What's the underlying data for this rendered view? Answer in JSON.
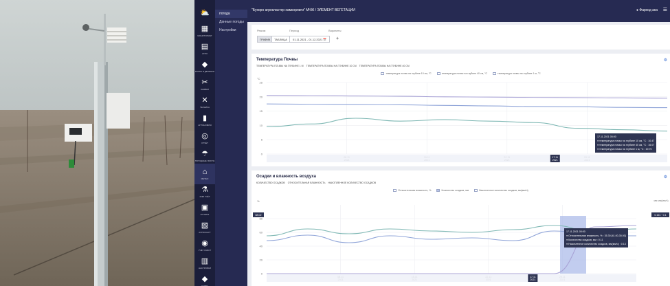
{
  "rail": {
    "items": [
      {
        "icon": "⛅",
        "label": "",
        "active": false
      },
      {
        "icon": "▦",
        "label": "МОНИТОРИНГ",
        "active": false
      },
      {
        "icon": "▤",
        "label": "АГРО",
        "active": false
      },
      {
        "icon": "◆",
        "label": "КАРТЫ И ДЕЛЯНКИ",
        "active": false
      },
      {
        "icon": "✂",
        "label": "ЗАЯВКИ",
        "active": false
      },
      {
        "icon": "✕",
        "label": "ТЕХНИКА",
        "active": false
      },
      {
        "icon": "▮",
        "label": "АГРОНОМИЯ",
        "active": false
      },
      {
        "icon": "◎",
        "label": "ОТЧЁТ",
        "active": false
      },
      {
        "icon": "☂",
        "label": "ПОГОДНЫЕ ЛИСТЫ",
        "active": false
      },
      {
        "icon": "⌂",
        "label": "МЕТЕО",
        "active": true
      },
      {
        "icon": "⚗",
        "label": "ХИМ УЧЁТ",
        "active": false
      },
      {
        "icon": "▣",
        "label": "ОТЧЕТЫ",
        "active": false
      },
      {
        "icon": "▧",
        "label": "АГРОСКАУТ",
        "active": false
      },
      {
        "icon": "◉",
        "label": "УЧЁТ РАБОТ",
        "active": false
      },
      {
        "icon": "▥",
        "label": "НАСТРОЙКИ",
        "active": false
      },
      {
        "icon": "◆",
        "label": "КАРТЫ",
        "active": false
      }
    ]
  },
  "sidebar": {
    "items": [
      {
        "label": "погода",
        "active": true
      },
      {
        "label": "Данные погоды",
        "active": false
      },
      {
        "label": "Настройки",
        "active": false
      }
    ]
  },
  "topbar": {
    "breadcrumb": "\"Бухоро агрокластер хамкорлиги\" МЧЖ  /  ЭЛЕМЕНТ ВЕГЕТАЦИИ",
    "user": "Фарход ака",
    "menu_icon": "☰"
  },
  "filters": {
    "view_label": "Режим",
    "period_label": "Период",
    "variants_label": "Варианты",
    "graph_button": "ГРАФИК",
    "table_button": "ТАБЛИЦА",
    "date_range": "01.11.2021 - 01.12.2021",
    "calendar_icon": "📅",
    "add_icon": "+"
  },
  "card1": {
    "title": "Температура Почвы",
    "tabs": [
      "ТЕМПЕРАТУРА ПОЧВЫ НА ГЛУБИНЕ 1 М",
      "ТЕМПЕРАТУРА ПОЧВЫ НА ГЛУБИНЕ 10 СМ",
      "ТЕМПЕРАТУРА ПОЧВЫ НА ГЛУБИНЕ 40 СМ"
    ],
    "legend": [
      "температура почвы на глубине 10 см, °C",
      "температура почвы на глубине 40 см, °C",
      "температура почвы на глубине 1 м, °C"
    ],
    "unit": "°C",
    "tooltip": [
      "17.11.2021 05:00",
      "● температура почвы на глубине 10 см, °C : 10.47",
      "● температура почвы на глубине 40 см, °C : 16.07",
      "● температура почвы на глубине 1 м, °C : 19.70"
    ],
    "x_ticks": [
      "08.11\n2021",
      "15.11\n2021",
      "22.11\n2021",
      "29.11\n2021"
    ],
    "x_highlight": "17.11\n2021"
  },
  "card2": {
    "title": "Осадки и влажность воздуха",
    "tabs": [
      "КОЛИЧЕСТВО ОСАДКОВ",
      "ОТНОСИТЕЛЬНАЯ ВЛАЖНОСТЬ",
      "НАКОПЛЕННОЕ КОЛИЧЕСТВО ОСАДКОВ"
    ],
    "legend": [
      "Относительная влажность, %",
      "Количество осадков, мм",
      "Накопленное количество осадков, мм(мм/ч)"
    ],
    "unit_left": "%",
    "unit_right": "мм  мм(мм/ч)",
    "tooltip": [
      "17.11.2021 05:00",
      "● Относительная влажность, % : 35.30 [41.00-35.00]",
      "● Количество осадков, мм : 0.11",
      "● Накопленное количество осадков, мм(мм/ч) : 0.13"
    ],
    "left_highlight": "88.02",
    "right_highlight": "0.161 · 0.1",
    "x_ticks": [
      "08.11\n2021",
      "15.11\n2021",
      "22.11\n2021",
      "29.11\n2021"
    ],
    "x_highlight": "17.11\n2021"
  },
  "colors": {
    "rail_bg": "#1b1e3a",
    "sidebar_bg": "#262a52",
    "series_teal": "#7fb8b4",
    "series_blue": "#8fa4d8",
    "series_violet": "#a9a3d6",
    "highlight_band": "#aebcea"
  },
  "chart_data": [
    {
      "type": "line",
      "title": "Температура Почвы",
      "ylabel": "°C",
      "xlabel": "",
      "ylim": [
        0,
        25
      ],
      "y_ticks": [
        0,
        5,
        10,
        15,
        20,
        25
      ],
      "x": [
        "01.11",
        "04.11",
        "08.11",
        "11.11",
        "15.11",
        "18.11",
        "22.11",
        "25.11",
        "29.11",
        "01.12"
      ],
      "series": [
        {
          "name": "температура почвы на глубине 10 см, °C",
          "values": [
            9.5,
            10.5,
            12.5,
            11.5,
            12.0,
            11.5,
            11.0,
            9.0,
            8.5,
            8.0
          ]
        },
        {
          "name": "температура почвы на глубине 40 см, °C",
          "values": [
            17.5,
            17.4,
            17.3,
            17.2,
            17.0,
            16.8,
            16.6,
            16.5,
            16.3,
            16.2
          ]
        },
        {
          "name": "температура почвы на глубине 1 м, °C",
          "values": [
            20.5,
            20.4,
            20.3,
            20.2,
            20.0,
            19.9,
            19.8,
            19.7,
            19.6,
            19.5
          ]
        }
      ],
      "grid": true
    },
    {
      "type": "line",
      "title": "Осадки и влажность воздуха",
      "ylabel": "%",
      "xlabel": "",
      "ylim": [
        0,
        100
      ],
      "y_ticks": [
        0,
        20,
        40,
        60,
        80
      ],
      "x": [
        "01.11",
        "04.11",
        "08.11",
        "11.11",
        "15.11",
        "18.11",
        "22.11",
        "25.11",
        "29.11",
        "01.12"
      ],
      "series": [
        {
          "name": "Относительная влажность, %",
          "values": [
            55,
            65,
            58,
            65,
            62,
            60,
            64,
            70,
            60,
            65
          ]
        },
        {
          "name": "Относительная влажность, %",
          "values": [
            48,
            56,
            45,
            55,
            50,
            52,
            48,
            62,
            55,
            55
          ]
        },
        {
          "name": "Накопленное количество осадков, мм(мм/ч)",
          "values": [
            0,
            0,
            0,
            0,
            0,
            0,
            0,
            0,
            68,
            70
          ]
        }
      ],
      "grid": true
    }
  ]
}
